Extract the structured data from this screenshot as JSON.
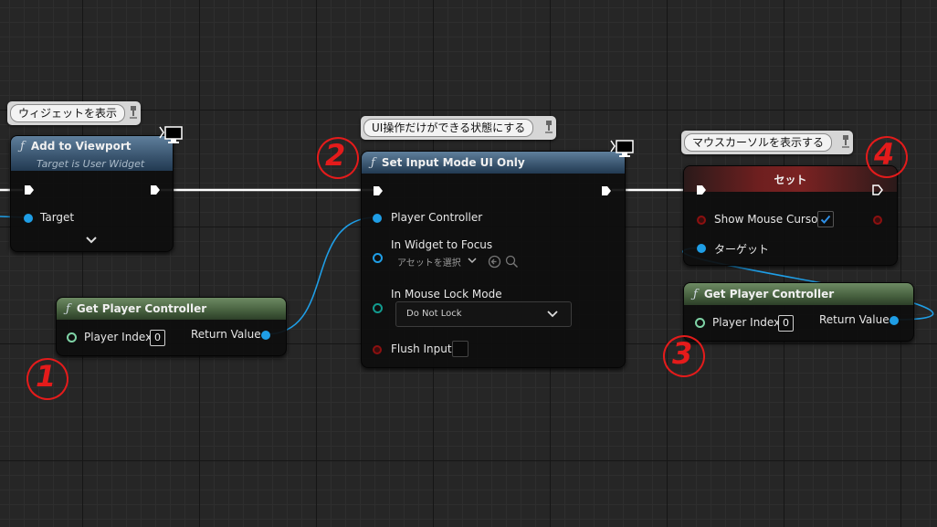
{
  "comments": {
    "add_to_viewport": "ウィジェットを表示",
    "set_input_mode": "UI操作だけができる状態にする",
    "set_cursor": "マウスカーソルを表示する"
  },
  "nodes": {
    "add_to_viewport": {
      "title": "Add to Viewport",
      "subtitle": "Target is User Widget",
      "pins": {
        "target": "Target"
      }
    },
    "get_player_controller_1": {
      "title": "Get Player Controller",
      "player_index_label": "Player Index",
      "player_index_value": "0",
      "return_value_label": "Return Value"
    },
    "set_input_mode": {
      "title": "Set Input Mode UI Only",
      "pins": {
        "player_controller": "Player Controller",
        "in_widget_to_focus": "In Widget to Focus",
        "asset_select": "アセットを選択",
        "in_mouse_lock_mode": "In Mouse Lock Mode",
        "mouse_lock_value": "Do Not Lock",
        "flush_input": "Flush Input"
      }
    },
    "set_node": {
      "title": "セット",
      "show_mouse_cursor_label": "Show Mouse Cursor",
      "show_mouse_cursor_checked": true,
      "target_label": "ターゲット"
    },
    "get_player_controller_2": {
      "title": "Get Player Controller",
      "player_index_label": "Player Index",
      "player_index_value": "0",
      "return_value_label": "Return Value"
    }
  },
  "annotations": [
    "1",
    "2",
    "3",
    "4"
  ],
  "colors": {
    "exec_wire": "#ffffff",
    "object_wire": "#1f9ee6",
    "annotation": "#e41b1b",
    "function_header": "#39546e",
    "pure_header": "#465f3e",
    "variable_header": "#7a2222"
  },
  "icons": {
    "function": "function-f-icon",
    "monitor": "monitor-icon",
    "comment_pin": "comment-pin-icon",
    "dropdown": "chevron-down-icon",
    "browse": "browse-arrow-icon",
    "search": "search-icon",
    "checkmark": "checkmark-icon"
  }
}
